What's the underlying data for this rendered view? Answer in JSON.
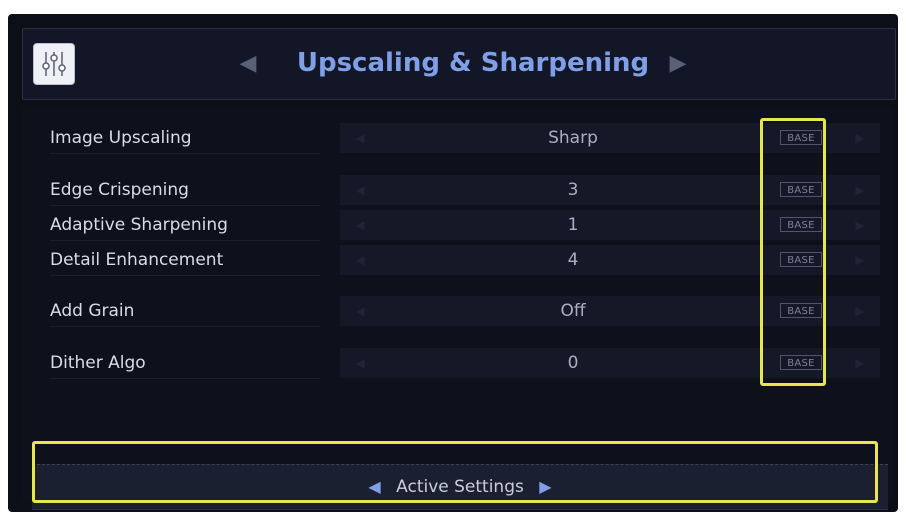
{
  "header": {
    "title": "Upscaling & Sharpening",
    "icon": "sliders-icon",
    "prev_arrow": "◀",
    "next_arrow": "▶"
  },
  "settings": [
    {
      "label": "Image Upscaling",
      "value": "Sharp",
      "badge": "BASE"
    },
    {
      "label": "Edge Crispening",
      "value": "3",
      "badge": "BASE"
    },
    {
      "label": "Adaptive Sharpening",
      "value": "1",
      "badge": "BASE"
    },
    {
      "label": "Detail Enhancement",
      "value": "4",
      "badge": "BASE"
    },
    {
      "label": "Add Grain",
      "value": "Off",
      "badge": "BASE"
    },
    {
      "label": "Dither Algo",
      "value": "0",
      "badge": "BASE"
    }
  ],
  "footer": {
    "label": "Active Settings",
    "prev_arrow": "◀",
    "next_arrow": "▶"
  },
  "colors": {
    "accent": "#7fa0e6",
    "highlight": "#e7e64c",
    "background": "#0d0f18"
  }
}
